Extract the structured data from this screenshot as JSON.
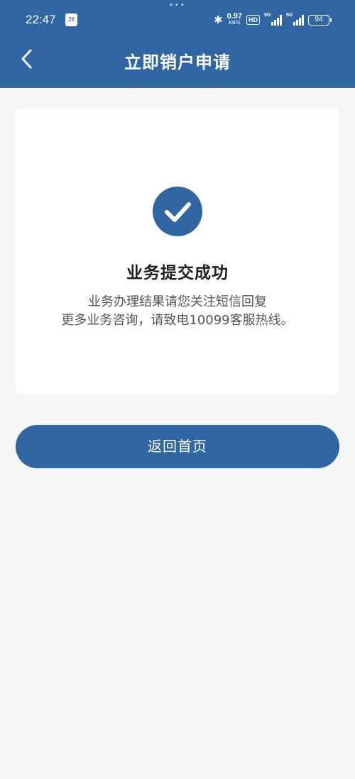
{
  "status_bar": {
    "time": "22:47",
    "calendar_day": "28",
    "net_speed_value": "0.97",
    "net_speed_unit": "KB/S",
    "hd_badge": "HD",
    "signal1_label": "5G",
    "signal2_label": "5G",
    "battery": "94"
  },
  "nav": {
    "title": "立即销户申请",
    "back_icon": "chevron-left-icon"
  },
  "result": {
    "icon": "check-circle-icon",
    "title": "业务提交成功",
    "line1": "业务办理结果请您关注短信回复",
    "line2": "更多业务咨询，请致电10099客服热线。"
  },
  "actions": {
    "home_button": "返回首页"
  },
  "colors": {
    "primary": "#2f66a3",
    "background": "#f6f6f6",
    "card": "#ffffff"
  }
}
